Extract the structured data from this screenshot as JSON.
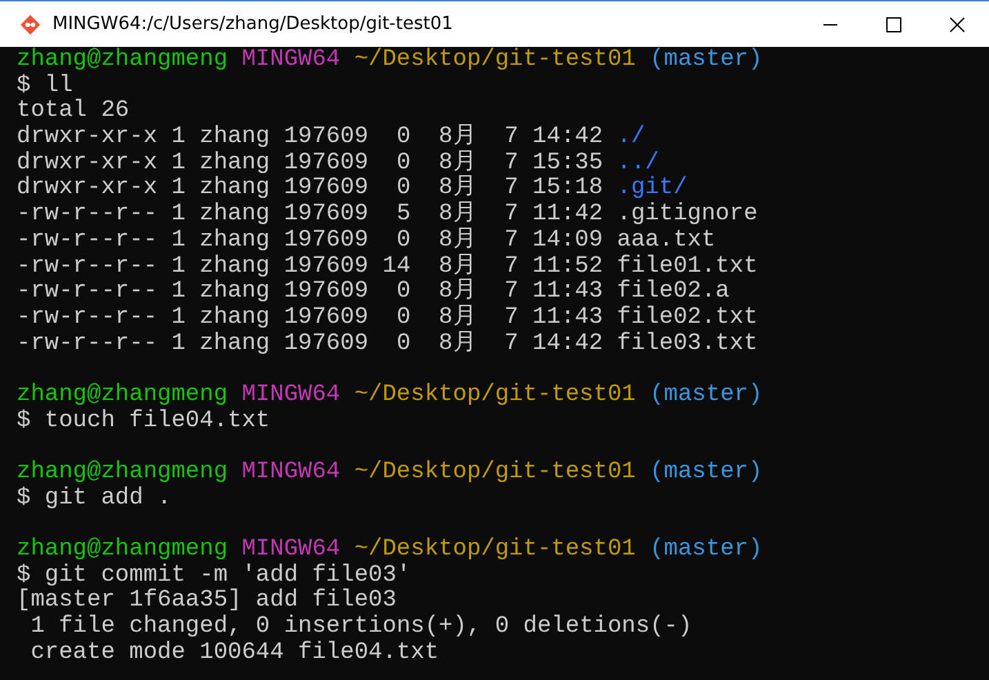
{
  "window": {
    "title": "MINGW64:/c/Users/zhang/Desktop/git-test01"
  },
  "terminal": {
    "lines": [
      {
        "kind": "prompt",
        "segments": [
          {
            "kind": "user",
            "text": "zhang@zhangmeng"
          },
          {
            "kind": "host",
            "text": "MINGW64"
          },
          {
            "kind": "path",
            "text": "~/Desktop/git-test01"
          },
          {
            "kind": "branch",
            "text": "(master)"
          }
        ]
      },
      {
        "kind": "text",
        "segments": [
          {
            "kind": "plain",
            "text": "$ ll"
          }
        ]
      },
      {
        "kind": "text",
        "segments": [
          {
            "kind": "plain",
            "text": "total 26"
          }
        ]
      },
      {
        "kind": "text",
        "segments": [
          {
            "kind": "plain",
            "text": "drwxr-xr-x 1 zhang 197609  0  8月  7 14:42 "
          },
          {
            "kind": "dir",
            "text": "./"
          }
        ]
      },
      {
        "kind": "text",
        "segments": [
          {
            "kind": "plain",
            "text": "drwxr-xr-x 1 zhang 197609  0  8月  7 15:35 "
          },
          {
            "kind": "dir",
            "text": "../"
          }
        ]
      },
      {
        "kind": "text",
        "segments": [
          {
            "kind": "plain",
            "text": "drwxr-xr-x 1 zhang 197609  0  8月  7 15:18 "
          },
          {
            "kind": "dir",
            "text": ".git/"
          }
        ]
      },
      {
        "kind": "text",
        "segments": [
          {
            "kind": "plain",
            "text": "-rw-r--r-- 1 zhang 197609  5  8月  7 11:42 .gitignore"
          }
        ]
      },
      {
        "kind": "text",
        "segments": [
          {
            "kind": "plain",
            "text": "-rw-r--r-- 1 zhang 197609  0  8月  7 14:09 aaa.txt"
          }
        ]
      },
      {
        "kind": "text",
        "segments": [
          {
            "kind": "plain",
            "text": "-rw-r--r-- 1 zhang 197609 14  8月  7 11:52 file01.txt"
          }
        ]
      },
      {
        "kind": "text",
        "segments": [
          {
            "kind": "plain",
            "text": "-rw-r--r-- 1 zhang 197609  0  8月  7 11:43 file02.a"
          }
        ]
      },
      {
        "kind": "text",
        "segments": [
          {
            "kind": "plain",
            "text": "-rw-r--r-- 1 zhang 197609  0  8月  7 11:43 file02.txt"
          }
        ]
      },
      {
        "kind": "text",
        "segments": [
          {
            "kind": "plain",
            "text": "-rw-r--r-- 1 zhang 197609  0  8月  7 14:42 file03.txt"
          }
        ]
      },
      {
        "kind": "blank"
      },
      {
        "kind": "prompt",
        "segments": [
          {
            "kind": "user",
            "text": "zhang@zhangmeng"
          },
          {
            "kind": "host",
            "text": "MINGW64"
          },
          {
            "kind": "path",
            "text": "~/Desktop/git-test01"
          },
          {
            "kind": "branch",
            "text": "(master)"
          }
        ]
      },
      {
        "kind": "text",
        "segments": [
          {
            "kind": "plain",
            "text": "$ touch file04.txt"
          }
        ]
      },
      {
        "kind": "blank"
      },
      {
        "kind": "prompt",
        "segments": [
          {
            "kind": "user",
            "text": "zhang@zhangmeng"
          },
          {
            "kind": "host",
            "text": "MINGW64"
          },
          {
            "kind": "path",
            "text": "~/Desktop/git-test01"
          },
          {
            "kind": "branch",
            "text": "(master)"
          }
        ]
      },
      {
        "kind": "text",
        "segments": [
          {
            "kind": "plain",
            "text": "$ git add ."
          }
        ]
      },
      {
        "kind": "blank"
      },
      {
        "kind": "prompt",
        "segments": [
          {
            "kind": "user",
            "text": "zhang@zhangmeng"
          },
          {
            "kind": "host",
            "text": "MINGW64"
          },
          {
            "kind": "path",
            "text": "~/Desktop/git-test01"
          },
          {
            "kind": "branch",
            "text": "(master)"
          }
        ]
      },
      {
        "kind": "text",
        "segments": [
          {
            "kind": "plain",
            "text": "$ git commit -m 'add file03'"
          }
        ]
      },
      {
        "kind": "text",
        "segments": [
          {
            "kind": "plain",
            "text": "[master 1f6aa35] add file03"
          }
        ]
      },
      {
        "kind": "text",
        "segments": [
          {
            "kind": "plain",
            "text": " 1 file changed, 0 insertions(+), 0 deletions(-)"
          }
        ]
      },
      {
        "kind": "text",
        "segments": [
          {
            "kind": "plain",
            "text": " create mode 100644 file04.txt"
          }
        ]
      }
    ]
  }
}
